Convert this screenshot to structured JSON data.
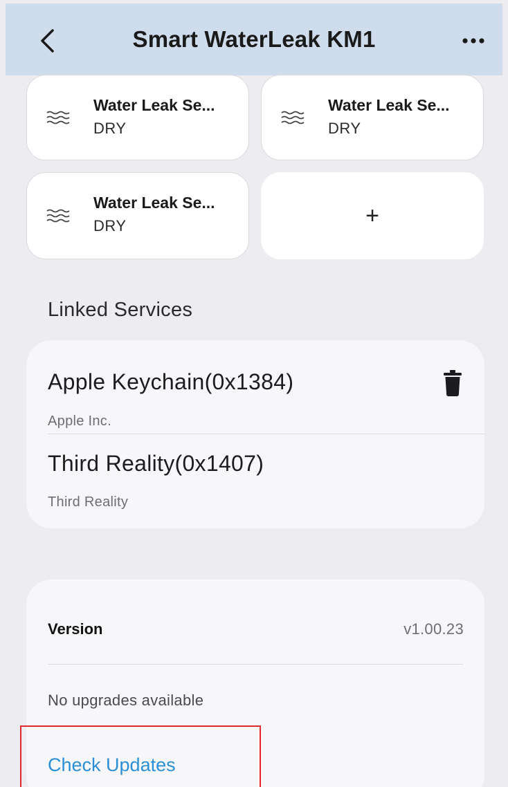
{
  "header": {
    "title": "Smart WaterLeak KM1",
    "back_icon": "chevron-left-icon",
    "more_icon": "ellipsis-icon",
    "background": "#cfdcec"
  },
  "sensors": [
    {
      "name": "Water Leak Se...",
      "state": "DRY",
      "icon": "water-waves-icon"
    },
    {
      "name": "Water Leak Se...",
      "state": "DRY",
      "icon": "water-waves-icon"
    },
    {
      "name": "Water Leak Se...",
      "state": "DRY",
      "icon": "water-waves-icon"
    }
  ],
  "add_tile": {
    "label": "+"
  },
  "linked_services": {
    "title": "Linked Services",
    "items": [
      {
        "name": "Apple Keychain(0x1384)",
        "vendor": "Apple Inc.",
        "action_icon": "trash-icon"
      },
      {
        "name": "Third Reality(0x1407)",
        "vendor": "Third Reality"
      }
    ]
  },
  "version": {
    "label": "Version",
    "value": "v1.00.23",
    "status": "No upgrades available",
    "check_label": "Check Updates",
    "link_color": "#2b8fd6"
  }
}
